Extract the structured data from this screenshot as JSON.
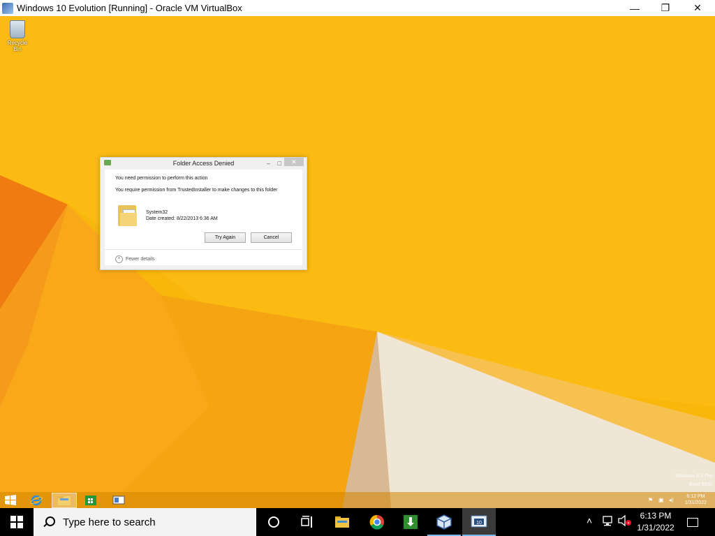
{
  "host_window": {
    "title": "Windows 10 Evolution [Running] - Oracle VM VirtualBox",
    "minimize_glyph": "—",
    "restore_glyph": "❐",
    "close_glyph": "✕"
  },
  "desktop": {
    "recycle_bin_label": "Recycle Bin"
  },
  "dialog": {
    "title": "Folder Access Denied",
    "message_heading": "You need permission to perform this action",
    "message_body": "You require permission from TrustedInstaller to make changes to this folder",
    "folder_name": "System32",
    "date_created": "Date created: 8/22/2013 6:36 AM",
    "try_again_label": "Try Again",
    "cancel_label": "Cancel",
    "fewer_details_label": "Fewer details"
  },
  "watermark": {
    "line1": "Windows 8.1 Pro",
    "line2": "Build 9600"
  },
  "guest_taskbar": {
    "time": "6:12 PM",
    "date": "1/31/2022"
  },
  "host_taskbar": {
    "search_placeholder": "Type here to search",
    "time": "6:13 PM",
    "date": "1/31/2022",
    "accent_color": "#76b9ed"
  }
}
